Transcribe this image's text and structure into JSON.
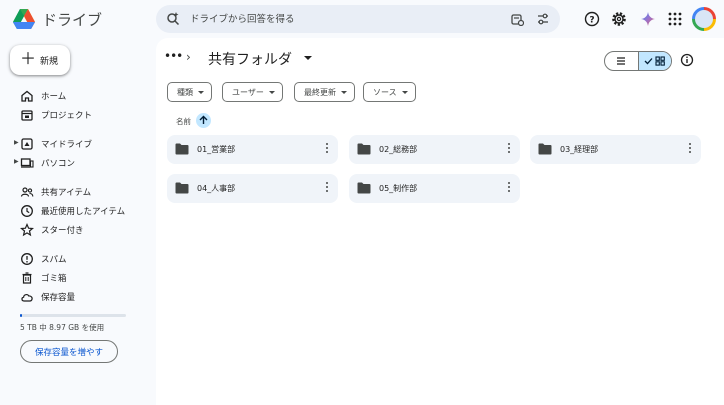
{
  "app": {
    "title": "ドライブ"
  },
  "search": {
    "placeholder": "ドライブから回答を得る"
  },
  "sidebar": {
    "new_label": "新規",
    "items": [
      {
        "label": "ホーム",
        "icon": "home-icon"
      },
      {
        "label": "プロジェクト",
        "icon": "project-icon"
      },
      {
        "label": "マイドライブ",
        "icon": "my-drive-icon",
        "expandable": true
      },
      {
        "label": "パソコン",
        "icon": "computer-icon",
        "expandable": true
      },
      {
        "label": "共有アイテム",
        "icon": "shared-icon"
      },
      {
        "label": "最近使用したアイテム",
        "icon": "recent-icon"
      },
      {
        "label": "スター付き",
        "icon": "star-icon"
      },
      {
        "label": "スパム",
        "icon": "spam-icon"
      },
      {
        "label": "ゴミ箱",
        "icon": "trash-icon"
      },
      {
        "label": "保存容量",
        "icon": "cloud-icon"
      }
    ],
    "storage": {
      "used_fraction": 0.0018,
      "text": "5 TB 中 8.97 GB を使用",
      "button_label": "保存容量を増やす"
    }
  },
  "main": {
    "breadcrumb_title": "共有フォルダ",
    "filters": [
      "種類",
      "ユーザー",
      "最終更新",
      "ソース"
    ],
    "sort_label": "名前",
    "folders": [
      "01_営業部",
      "02_総務部",
      "03_経理部",
      "04_人事部",
      "05_制作部"
    ]
  },
  "colors": {
    "accent": "#0b57d0",
    "selected": "#c2e7ff",
    "card": "#f0f4f9"
  }
}
